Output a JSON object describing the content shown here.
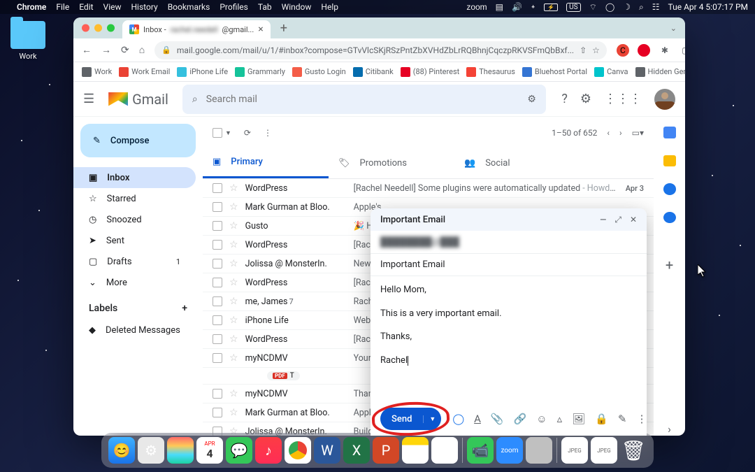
{
  "macos_menu": {
    "app": "Chrome",
    "items": [
      "File",
      "Edit",
      "View",
      "History",
      "Bookmarks",
      "Profiles",
      "Tab",
      "Window",
      "Help"
    ],
    "right": {
      "zoom": "zoom",
      "input": "US",
      "datetime": "Tue Apr 4  5:07:17 PM"
    }
  },
  "desktop": {
    "folder_label": "Work"
  },
  "browser": {
    "tab_title_prefix": "Inbox - ",
    "tab_title_suffix": "@gmail...",
    "url": "mail.google.com/mail/u/1/#inbox?compose=GTvVlcSKjRSzPntZbXVHdZbLrRQBhnjCqczpRKVSFmQbBxf...",
    "bookmarks": [
      {
        "label": "Work",
        "color": "#5f6368"
      },
      {
        "label": "Work Email",
        "color": "#ea4335"
      },
      {
        "label": "iPhone Life",
        "color": "#35c0de"
      },
      {
        "label": "Grammarly",
        "color": "#15c39a"
      },
      {
        "label": "Gusto Login",
        "color": "#f45d48"
      },
      {
        "label": "Citibank",
        "color": "#056dae"
      },
      {
        "label": "(88) Pinterest",
        "color": "#e60023"
      },
      {
        "label": "Thesaurus",
        "color": "#f44336"
      },
      {
        "label": "Bluehost Portal",
        "color": "#3575d3"
      },
      {
        "label": "Canva",
        "color": "#00c4cc"
      },
      {
        "label": "Hidden Gems",
        "color": "#5f6368"
      }
    ]
  },
  "gmail": {
    "logo": "Gmail",
    "search_placeholder": "Search mail",
    "compose_label": "Compose",
    "nav": [
      {
        "icon": "inbox",
        "label": "Inbox",
        "active": true
      },
      {
        "icon": "star",
        "label": "Starred"
      },
      {
        "icon": "clock",
        "label": "Snoozed"
      },
      {
        "icon": "send",
        "label": "Sent"
      },
      {
        "icon": "draft",
        "label": "Drafts",
        "count": "1"
      },
      {
        "icon": "more",
        "label": "More"
      }
    ],
    "labels_header": "Labels",
    "labels": [
      {
        "label": "Deleted Messages"
      }
    ],
    "pagination": "1–50 of 652",
    "tabs": [
      {
        "label": "Primary",
        "active": true
      },
      {
        "label": "Promotions"
      },
      {
        "label": "Social"
      }
    ],
    "emails": [
      {
        "sender": "WordPress",
        "subject": "[Rachel Needell] Some plugins were automatically updated",
        "preview": " - Howdy! So...",
        "date": "Apr 3"
      },
      {
        "sender": "Mark Gurman at Bloo.",
        "subject": "Apple's"
      },
      {
        "sender": "Gusto",
        "subject": "🎉 Hey"
      },
      {
        "sender": "WordPress",
        "subject": "[Rache"
      },
      {
        "sender": "Jolissa @ MonsterIn.",
        "subject": "New PF"
      },
      {
        "sender": "WordPress",
        "subject": "[Rache"
      },
      {
        "sender": "me, James",
        "count": "7",
        "subject": "Rachel"
      },
      {
        "sender": "iPhone Life",
        "subject": "Webina"
      },
      {
        "sender": "WordPress",
        "subject": "[Rache"
      },
      {
        "sender": "myNCDMV",
        "subject": "Your m",
        "attachment": "T"
      },
      {
        "sender": "myNCDMV",
        "subject": "Thanks"
      },
      {
        "sender": "Mark Gurman at Bloo.",
        "subject": "Apple's"
      },
      {
        "sender": "Jolissa @ MonsterIn.",
        "subject": "Build a"
      }
    ]
  },
  "compose": {
    "title": "Important Email",
    "to": "████████@███",
    "subject": "Important Email",
    "body": [
      "Hello Mom,",
      "This is a very important email.",
      "Thanks,",
      "Rachel"
    ],
    "send_label": "Send"
  }
}
